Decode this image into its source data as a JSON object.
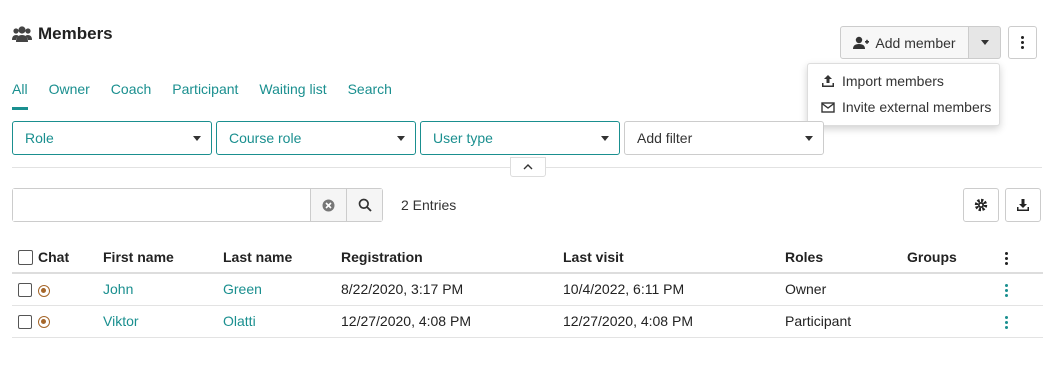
{
  "header": {
    "title": "Members",
    "title_icon": "users-icon"
  },
  "actions": {
    "add_member": "Add member",
    "dropdown": [
      {
        "label": "Import members",
        "icon": "upload-icon"
      },
      {
        "label": "Invite external members",
        "icon": "envelope-icon"
      }
    ]
  },
  "tabs": [
    "All",
    "Owner",
    "Coach",
    "Participant",
    "Waiting list",
    "Search"
  ],
  "active_tab": "All",
  "filters": {
    "role": "Role",
    "course_role": "Course role",
    "user_type": "User type",
    "add_filter": "Add filter"
  },
  "search": {
    "value": "",
    "placeholder": ""
  },
  "entries": "2 Entries",
  "table": {
    "headers": {
      "chat": "Chat",
      "first_name": "First name",
      "last_name": "Last name",
      "registration": "Registration",
      "last_visit": "Last visit",
      "roles": "Roles",
      "groups": "Groups"
    },
    "rows": [
      {
        "first_name": "John",
        "last_name": "Green",
        "registration": "8/22/2020, 3:17 PM",
        "last_visit": "10/4/2022, 6:11 PM",
        "roles": "Owner",
        "groups": ""
      },
      {
        "first_name": "Viktor",
        "last_name": "Olatti",
        "registration": "12/27/2020, 4:08 PM",
        "last_visit": "12/27/2020, 4:08 PM",
        "roles": "Participant",
        "groups": ""
      }
    ]
  },
  "colors": {
    "accent": "#1a8f8f",
    "chat_status": "#a5662a"
  }
}
